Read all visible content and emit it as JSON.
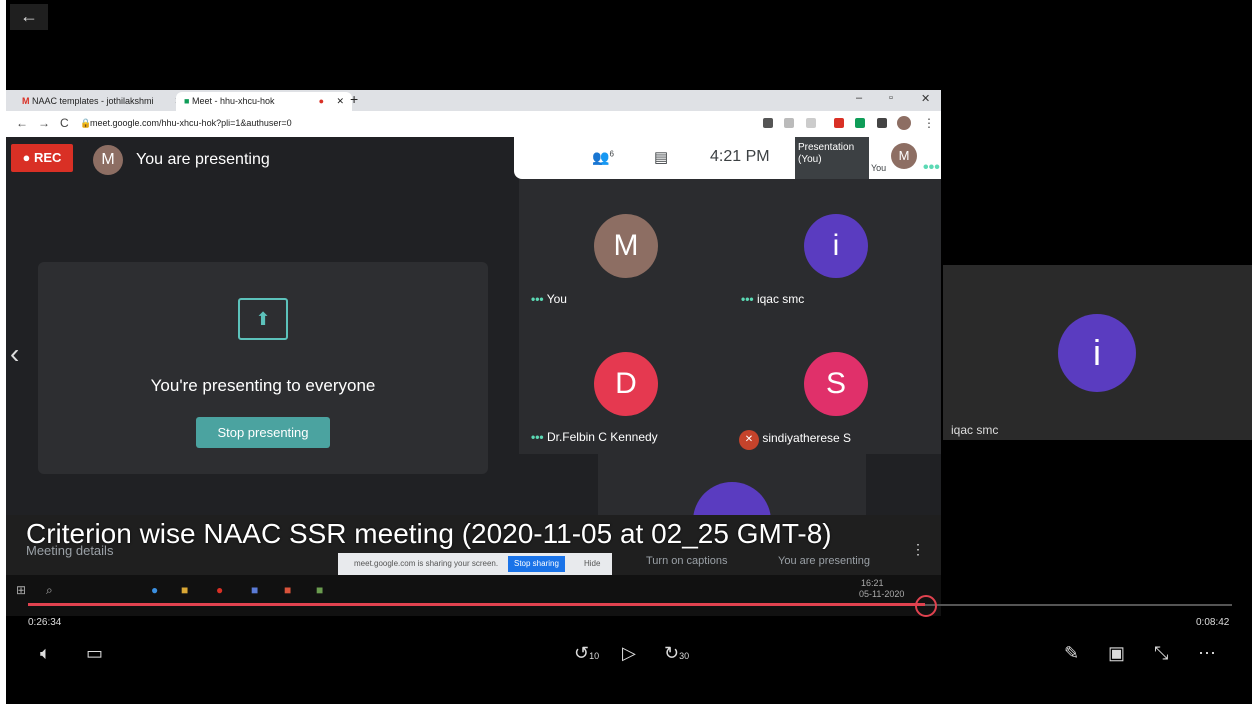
{
  "back_icon": "←",
  "browser": {
    "tabs": [
      {
        "label": "NAAC templates - jothilakshmi",
        "icon": "gmail-icon"
      },
      {
        "label": "Meet - hhu-xhcu-hok",
        "icon": "meet-icon"
      }
    ],
    "url": "meet.google.com/hhu-xhcu-hok?pli=1&authuser=0"
  },
  "meet": {
    "rec_label": "REC",
    "self_initial": "M",
    "presenting_label": "You are presenting",
    "participant_count": "6",
    "clock": "4:21 PM",
    "presentation_label": "Presentation (You)",
    "you_label": "You",
    "panel_text": "You're presenting to everyone",
    "stop_button": "Stop presenting",
    "participants": [
      {
        "initial": "M",
        "name": "You",
        "color": "#8d6e63"
      },
      {
        "initial": "i",
        "name": "iqac smc",
        "color": "#5a3cc0"
      },
      {
        "initial": "D",
        "name": "Dr.Felbin C Kennedy",
        "color": "#e53950"
      },
      {
        "initial": "S",
        "name": "sindiyatherese S",
        "color": "#e0306a"
      }
    ],
    "meeting_details": "Meeting details",
    "captions_label": "Turn on captions",
    "you_presenting": "You are presenting",
    "sharing_notice": "meet.google.com is sharing your screen.",
    "stop_sharing": "Stop sharing",
    "hide": "Hide",
    "taskbar_time": "16:21",
    "taskbar_date": "05-11-2020"
  },
  "video_title": "Criterion wise NAAC SSR meeting (2020-11-05 at 02_25 GMT-8)",
  "side_tile": {
    "initial": "i",
    "name": "iqac smc"
  },
  "player": {
    "elapsed": "0:26:34",
    "remaining": "0:08:42",
    "progress": 0.745,
    "skip_back": "10",
    "skip_forward": "30"
  }
}
